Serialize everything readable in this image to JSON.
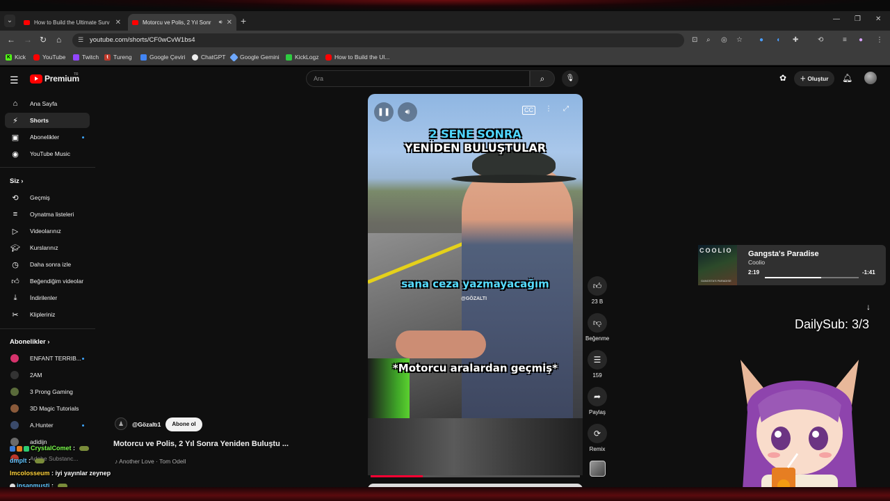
{
  "browser": {
    "tabs": [
      {
        "title": "How to Build the Ultimate Surv",
        "active": false
      },
      {
        "title": "Motorcu ve Polis, 2 Yıl Sonr",
        "active": true
      }
    ],
    "url": "youtube.com/shorts/CF0wCvW1bs4",
    "bookmarks": [
      "Kick",
      "YouTube",
      "Twitch",
      "Tureng",
      "Google Çeviri",
      "ChatGPT",
      "Google Gemini",
      "KickLogz",
      "How to Build the Ul..."
    ]
  },
  "header": {
    "logo_text": "Premium",
    "logo_region": "TR",
    "search_placeholder": "Ara",
    "create_label": "Oluştur"
  },
  "sidebar": {
    "main": [
      {
        "label": "Ana Sayfa",
        "icon": "home-icon"
      },
      {
        "label": "Shorts",
        "icon": "shorts-icon",
        "active": true
      },
      {
        "label": "Abonelikler",
        "icon": "subscriptions-icon",
        "dot": true
      },
      {
        "label": "YouTube Music",
        "icon": "music-icon"
      }
    ],
    "you_heading": "Siz",
    "you": [
      {
        "label": "Geçmiş",
        "icon": "history-icon"
      },
      {
        "label": "Oynatma listeleri",
        "icon": "playlists-icon"
      },
      {
        "label": "Videolarınız",
        "icon": "your-videos-icon"
      },
      {
        "label": "Kurslarınız",
        "icon": "courses-icon"
      },
      {
        "label": "Daha sonra izle",
        "icon": "watch-later-icon"
      },
      {
        "label": "Beğendiğim videolar",
        "icon": "liked-icon"
      },
      {
        "label": "İndirilenler",
        "icon": "downloads-icon"
      },
      {
        "label": "Klipleriniz",
        "icon": "clips-icon"
      }
    ],
    "subs_heading": "Abonelikler",
    "subs": [
      {
        "label": "ENFANT TERRIB...",
        "color": "#d6336c",
        "dot": true
      },
      {
        "label": "2AM",
        "color": "#333333",
        "dot": false
      },
      {
        "label": "3 Prong Gaming",
        "color": "#5a6b3a",
        "dot": false
      },
      {
        "label": "3D Magic Tutorials",
        "color": "#8a5a3a",
        "dot": false
      },
      {
        "label": "A.Hunter",
        "color": "#3a4a6a",
        "dot": true
      },
      {
        "label": "adidijn",
        "color": "#6a6a6a",
        "dot": false
      },
      {
        "label": "Adobe Substanc...",
        "color": "#c0392b",
        "dot": false
      }
    ]
  },
  "short": {
    "captions": {
      "top1": "2 SENE SONRA",
      "top2": "YENİDEN BULUŞTULAR",
      "middle": "sana ceza yazmayacağım",
      "watermark": "@GÖZALTI",
      "bottom": "*Motorcu aralardan geçmiş*"
    },
    "channel": "@Gözaltı1",
    "subscribe_label": "Abone ol",
    "title": "Motorcu ve Polis, 2 Yıl Sonra Yeniden Buluştu ...",
    "music": "Another Love · Tom Odell",
    "progress": 0.25,
    "actions": {
      "like_count": "23 B",
      "dislike_label": "Beğenme",
      "comment_count": "159",
      "share_label": "Paylaş",
      "remix_label": "Remix"
    }
  },
  "overlay": {
    "now_playing": {
      "art_title": "COOLIO",
      "art_subtitle": "GANGSTA'S PARADISE",
      "title": "Gangsta's Paradise",
      "artist": "Coolio",
      "elapsed": "2:19",
      "remaining": "-1:41",
      "progress": 0.6
    },
    "dailysub": "DailySub: 3/3"
  },
  "chat": [
    {
      "user": "CrystalComet",
      "message": "",
      "emote": true,
      "color": "u1"
    },
    {
      "user": "dmplt",
      "message": "",
      "emote": true,
      "color": "u3"
    },
    {
      "user": "lmcolosseum",
      "message": "iyi yayınlar zeynep",
      "emote": false,
      "color": "u2"
    },
    {
      "user": "insanmusti",
      "message": "",
      "emote": true,
      "color": "u3"
    }
  ]
}
